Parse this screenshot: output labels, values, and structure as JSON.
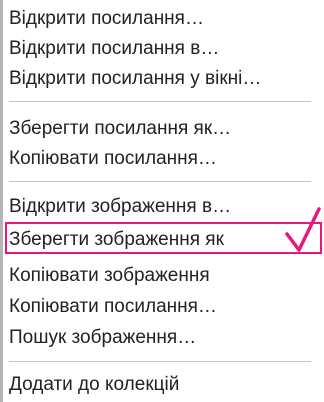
{
  "context_menu": {
    "group1": [
      {
        "label": "Відкрити посилання…"
      },
      {
        "label": "Відкрити посилання в…"
      },
      {
        "label": "Відкрити посилання у вікні…"
      }
    ],
    "group2": [
      {
        "label": "Зберегти посилання як…"
      },
      {
        "label": "Копіювати посилання…"
      }
    ],
    "group3": [
      {
        "label": "Відкрити зображення в…"
      },
      {
        "label": "Зберегти зображення як"
      },
      {
        "label": "Копіювати зображення"
      },
      {
        "label": "Копіювати посилання…"
      },
      {
        "label": "Пошук зображення…"
      }
    ],
    "group4": [
      {
        "label": "Додати до колекцій"
      }
    ]
  },
  "annotation": {
    "highlight_color": "#e8177f",
    "checkmark_icon": "checkmark-icon"
  }
}
